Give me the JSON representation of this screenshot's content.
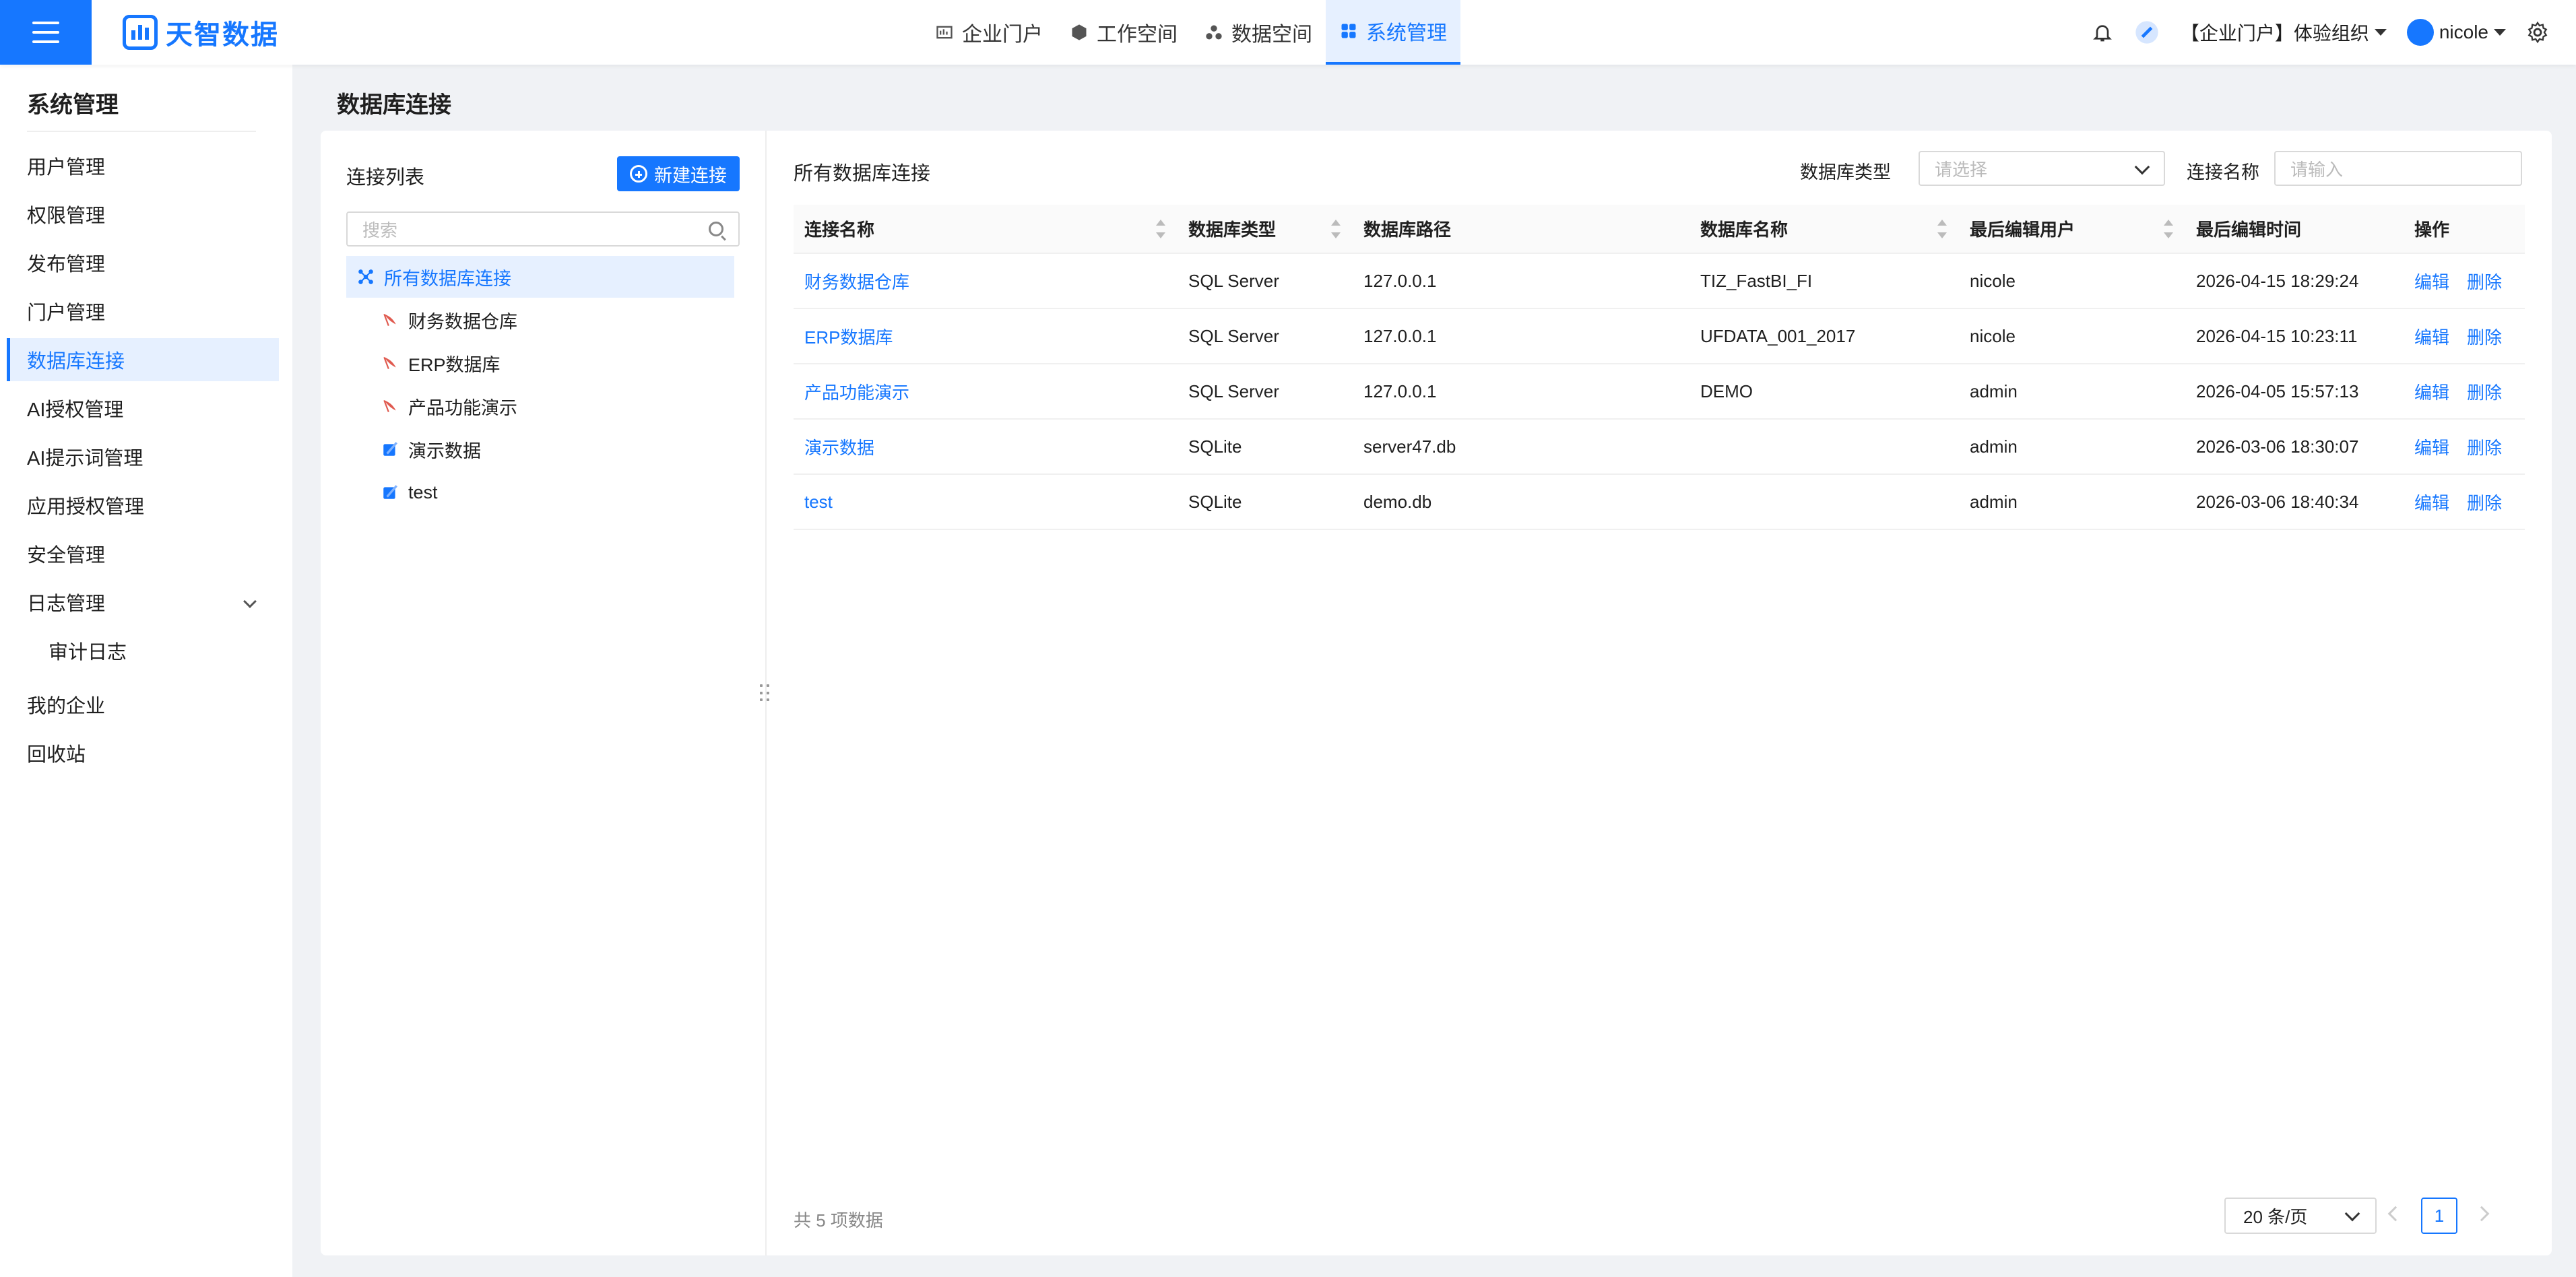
{
  "app": {
    "logo_text": "天智数据",
    "nav": [
      {
        "label": "企业门户",
        "icon": "portal-icon"
      },
      {
        "label": "工作空间",
        "icon": "workspace-icon"
      },
      {
        "label": "数据空间",
        "icon": "dataspace-icon"
      },
      {
        "label": "系统管理",
        "icon": "system-icon",
        "active": true
      }
    ],
    "org_selector": "【企业门户】体验组织",
    "user": "nicole"
  },
  "sidebar": {
    "title": "系统管理",
    "items": [
      {
        "label": "用户管理"
      },
      {
        "label": "权限管理"
      },
      {
        "label": "发布管理"
      },
      {
        "label": "门户管理"
      },
      {
        "label": "数据库连接",
        "active": true
      },
      {
        "label": "AI授权管理"
      },
      {
        "label": "AI提示词管理"
      },
      {
        "label": "应用授权管理"
      },
      {
        "label": "安全管理"
      },
      {
        "label": "日志管理",
        "expandable": true
      },
      {
        "label": "审计日志",
        "sub": true
      },
      {
        "label": "我的企业"
      },
      {
        "label": "回收站"
      }
    ]
  },
  "page": {
    "title": "数据库连接"
  },
  "left_panel": {
    "title": "连接列表",
    "new_button": "新建连接",
    "search_placeholder": "搜索",
    "tree": [
      {
        "label": "所有数据库连接",
        "root": true,
        "active": true
      },
      {
        "label": "财务数据仓库",
        "icon": "sqlserver-icon"
      },
      {
        "label": "ERP数据库",
        "icon": "sqlserver-icon"
      },
      {
        "label": "产品功能演示",
        "icon": "sqlserver-icon"
      },
      {
        "label": "演示数据",
        "icon": "sqlite-icon"
      },
      {
        "label": "test",
        "icon": "sqlite-icon"
      }
    ]
  },
  "right_panel": {
    "title": "所有数据库连接",
    "filter_type_label": "数据库类型",
    "filter_type_placeholder": "请选择",
    "filter_name_label": "连接名称",
    "filter_name_placeholder": "请输入",
    "columns": [
      "连接名称",
      "数据库类型",
      "数据库路径",
      "数据库名称",
      "最后编辑用户",
      "最后编辑时间",
      "操作"
    ],
    "rows": [
      {
        "name": "财务数据仓库",
        "type": "SQL Server",
        "path": "127.0.0.1",
        "db": "TIZ_FastBI_FI",
        "user": "nicole",
        "time": "2026-04-15 18:29:24"
      },
      {
        "name": "ERP数据库",
        "type": "SQL Server",
        "path": "127.0.0.1",
        "db": "UFDATA_001_2017",
        "user": "nicole",
        "time": "2026-04-15 10:23:11"
      },
      {
        "name": "产品功能演示",
        "type": "SQL Server",
        "path": "127.0.0.1",
        "db": "DEMO",
        "user": "admin",
        "time": "2026-04-05 15:57:13"
      },
      {
        "name": "演示数据",
        "type": "SQLite",
        "path": "server47.db",
        "db": "",
        "user": "admin",
        "time": "2026-03-06 18:30:07"
      },
      {
        "name": "test",
        "type": "SQLite",
        "path": "demo.db",
        "db": "",
        "user": "admin",
        "time": "2026-03-06 18:40:34"
      }
    ],
    "op_edit": "编辑",
    "op_delete": "删除",
    "total_text": "共 5 项数据",
    "page_size": "20 条/页",
    "current_page": "1"
  },
  "colors": {
    "accent": "#1677ff",
    "active_bg": "#e6f0ff",
    "sqlserver": "#e05a4f",
    "sqlite": "#1677ff"
  }
}
